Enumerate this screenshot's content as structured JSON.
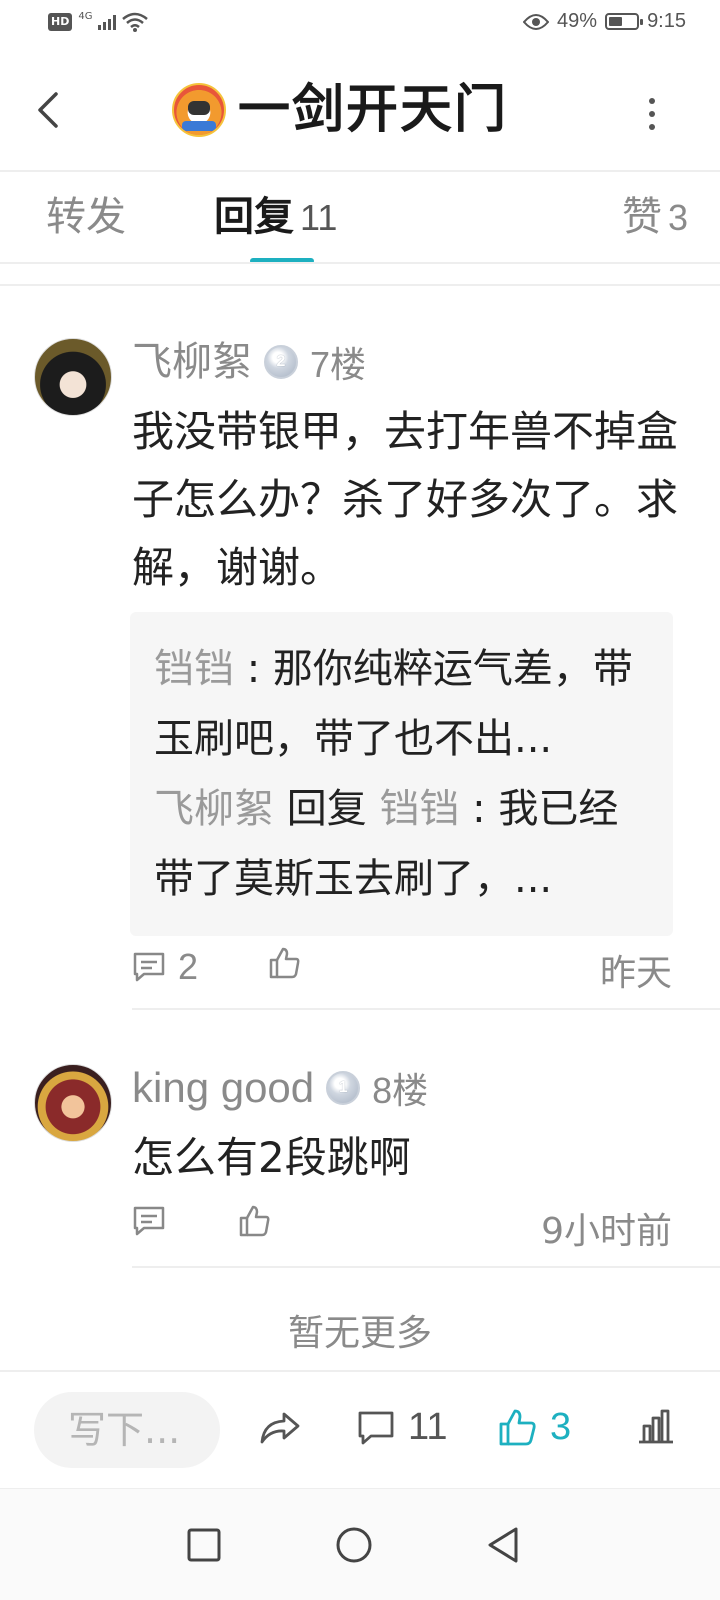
{
  "status_bar": {
    "hd": "HD",
    "network": "4G",
    "battery_percent": "49%",
    "battery_level": 0.49,
    "time": "9:15"
  },
  "header": {
    "title": "一剑开天门"
  },
  "tabs": [
    {
      "label": "转发",
      "count": ""
    },
    {
      "label": "回复",
      "count": "11",
      "active": true
    },
    {
      "label": "赞",
      "count": "3"
    }
  ],
  "comments": [
    {
      "user": "飞柳絮",
      "badge": "2",
      "floor": "7楼",
      "text": "我没带银甲，去打年兽不掉盒子怎么办？杀了好多次了。求解，谢谢。",
      "replies": [
        {
          "user": "铛铛",
          "text": "那你纯粹运气差，带玉刷吧，带了也不出..."
        },
        {
          "user": "飞柳絮",
          "verb": "回复",
          "target": "铛铛",
          "text": "我已经带了莫斯玉去刷了，..."
        }
      ],
      "comment_count": "2",
      "time": "昨天"
    },
    {
      "user": "king good",
      "badge": "1",
      "floor": "8楼",
      "text": "怎么有2段跳啊",
      "comment_count": "",
      "time": "9小时前"
    }
  ],
  "no_more_text": "暂无更多",
  "bottom_bar": {
    "input_placeholder": "写下...",
    "comment_count": "11",
    "like_count": "3",
    "accent_color": "#1db0c0"
  }
}
